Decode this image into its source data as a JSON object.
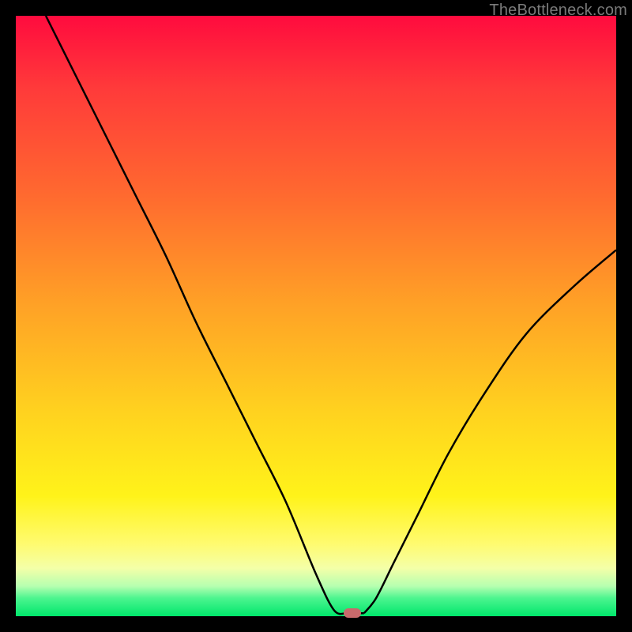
{
  "watermark": "TheBottleneck.com",
  "chart_data": {
    "type": "line",
    "title": "",
    "xlabel": "",
    "ylabel": "",
    "xlim": [
      0,
      100
    ],
    "ylim": [
      0,
      100
    ],
    "grid": false,
    "legend": false,
    "series": [
      {
        "name": "left-branch",
        "x": [
          5,
          10,
          15,
          20,
          25,
          30,
          35,
          40,
          45,
          50,
          53,
          55
        ],
        "y": [
          100,
          90,
          80,
          70,
          60,
          49,
          39,
          29,
          19,
          7,
          1,
          0.5
        ]
      },
      {
        "name": "right-branch",
        "x": [
          58,
          60,
          63,
          67,
          72,
          78,
          85,
          93,
          100
        ],
        "y": [
          0.5,
          3,
          9,
          17,
          27,
          37,
          47,
          55,
          61
        ]
      }
    ],
    "marker": {
      "x": 56,
      "y": 0.5
    },
    "background_gradient": {
      "stops": [
        {
          "pos": 0,
          "color": "#ff0b3e"
        },
        {
          "pos": 12,
          "color": "#ff3a3a"
        },
        {
          "pos": 30,
          "color": "#ff6a2f"
        },
        {
          "pos": 48,
          "color": "#ffa126"
        },
        {
          "pos": 66,
          "color": "#ffd21f"
        },
        {
          "pos": 80,
          "color": "#fff31a"
        },
        {
          "pos": 88,
          "color": "#fffb70"
        },
        {
          "pos": 92,
          "color": "#f4ffa8"
        },
        {
          "pos": 95,
          "color": "#b6ffb0"
        },
        {
          "pos": 97,
          "color": "#4cf58f"
        },
        {
          "pos": 100,
          "color": "#00e66b"
        }
      ]
    },
    "line_color": "#000000",
    "marker_color": "#c96a6c"
  }
}
